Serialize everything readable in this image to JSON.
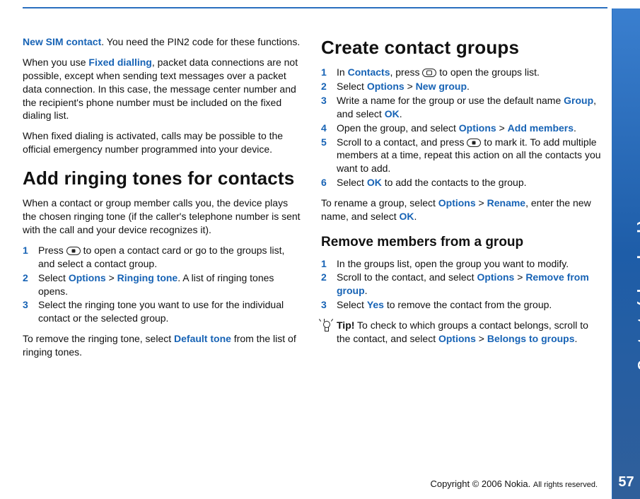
{
  "sidebar": {
    "section_label": "Contacts (phonebook)",
    "page_number": "57"
  },
  "footer": {
    "prefix": "Copyright © 2006 Nokia.",
    "suffix": "All rights reserved."
  },
  "col1": {
    "p1": {
      "t1": "New SIM contact",
      "t2": ". You need the PIN2 code for these functions."
    },
    "p2": {
      "t1": "When you use ",
      "t2": "Fixed dialling",
      "t3": ", packet data connections are not possible, except when sending text messages over a packet data connection. In this case, the message center number and the recipient's phone number must be included on the fixed dialing list."
    },
    "p3": "When fixed dialing is activated, calls may be possible to the official emergency number programmed into your device.",
    "h1": "Add ringing tones for contacts",
    "p4": "When a contact or group member calls you, the device plays the chosen ringing tone (if the caller's telephone number is sent with the call and your device recognizes it).",
    "steps": [
      {
        "n": "1",
        "a": "Press ",
        "b": " to open a contact card or go to the groups list, and select a contact group."
      },
      {
        "n": "2",
        "a": "Select ",
        "t1": "Options",
        "sep": " > ",
        "t2": "Ringing tone",
        "b": ". A list of ringing tones opens."
      },
      {
        "n": "3",
        "a": "Select the ringing tone you want to use for the individual contact or the selected group."
      }
    ],
    "p5": {
      "a": "To remove the ringing tone, select ",
      "t1": "Default tone",
      "b": " from the list of ringing tones."
    }
  },
  "col2": {
    "h1": "Create contact groups",
    "steps1": [
      {
        "n": "1",
        "a": "In ",
        "t1": "Contacts",
        "b": ", press ",
        "c": " to open the groups list."
      },
      {
        "n": "2",
        "a": "Select ",
        "t1": "Options",
        "sep": " > ",
        "t2": "New group",
        "b": "."
      },
      {
        "n": "3",
        "a": "Write a name for the group or use the default name ",
        "t1": "Group",
        "b": ", and select ",
        "t2": "OK",
        "c": "."
      },
      {
        "n": "4",
        "a": "Open the group, and select ",
        "t1": "Options",
        "sep": " > ",
        "t2": "Add members",
        "b": "."
      },
      {
        "n": "5",
        "a": "Scroll to a contact, and press ",
        "b": " to mark it. To add multiple members at a time, repeat this action on all the contacts you want to add."
      },
      {
        "n": "6",
        "a": "Select ",
        "t1": "OK",
        "b": " to add the contacts to the group."
      }
    ],
    "p1": {
      "a": "To rename a group, select ",
      "t1": "Options",
      "sep": " > ",
      "t2": "Rename",
      "b": ", enter the new name, and select ",
      "t3": "OK",
      "c": "."
    },
    "h2": "Remove members from a group",
    "steps2": [
      {
        "n": "1",
        "a": "In the groups list, open the group you want to modify."
      },
      {
        "n": "2",
        "a": "Scroll to the contact, and select ",
        "t1": "Options",
        "sep": " > ",
        "t2": "Remove from group",
        "b": "."
      },
      {
        "n": "3",
        "a": "Select ",
        "t1": "Yes",
        "b": " to remove the contact from the group."
      }
    ],
    "tip": {
      "label": "Tip!",
      "a": " To check to which groups a contact belongs, scroll to the contact, and select ",
      "t1": "Options",
      "sep": " > ",
      "t2": "Belongs to groups",
      "b": "."
    }
  }
}
